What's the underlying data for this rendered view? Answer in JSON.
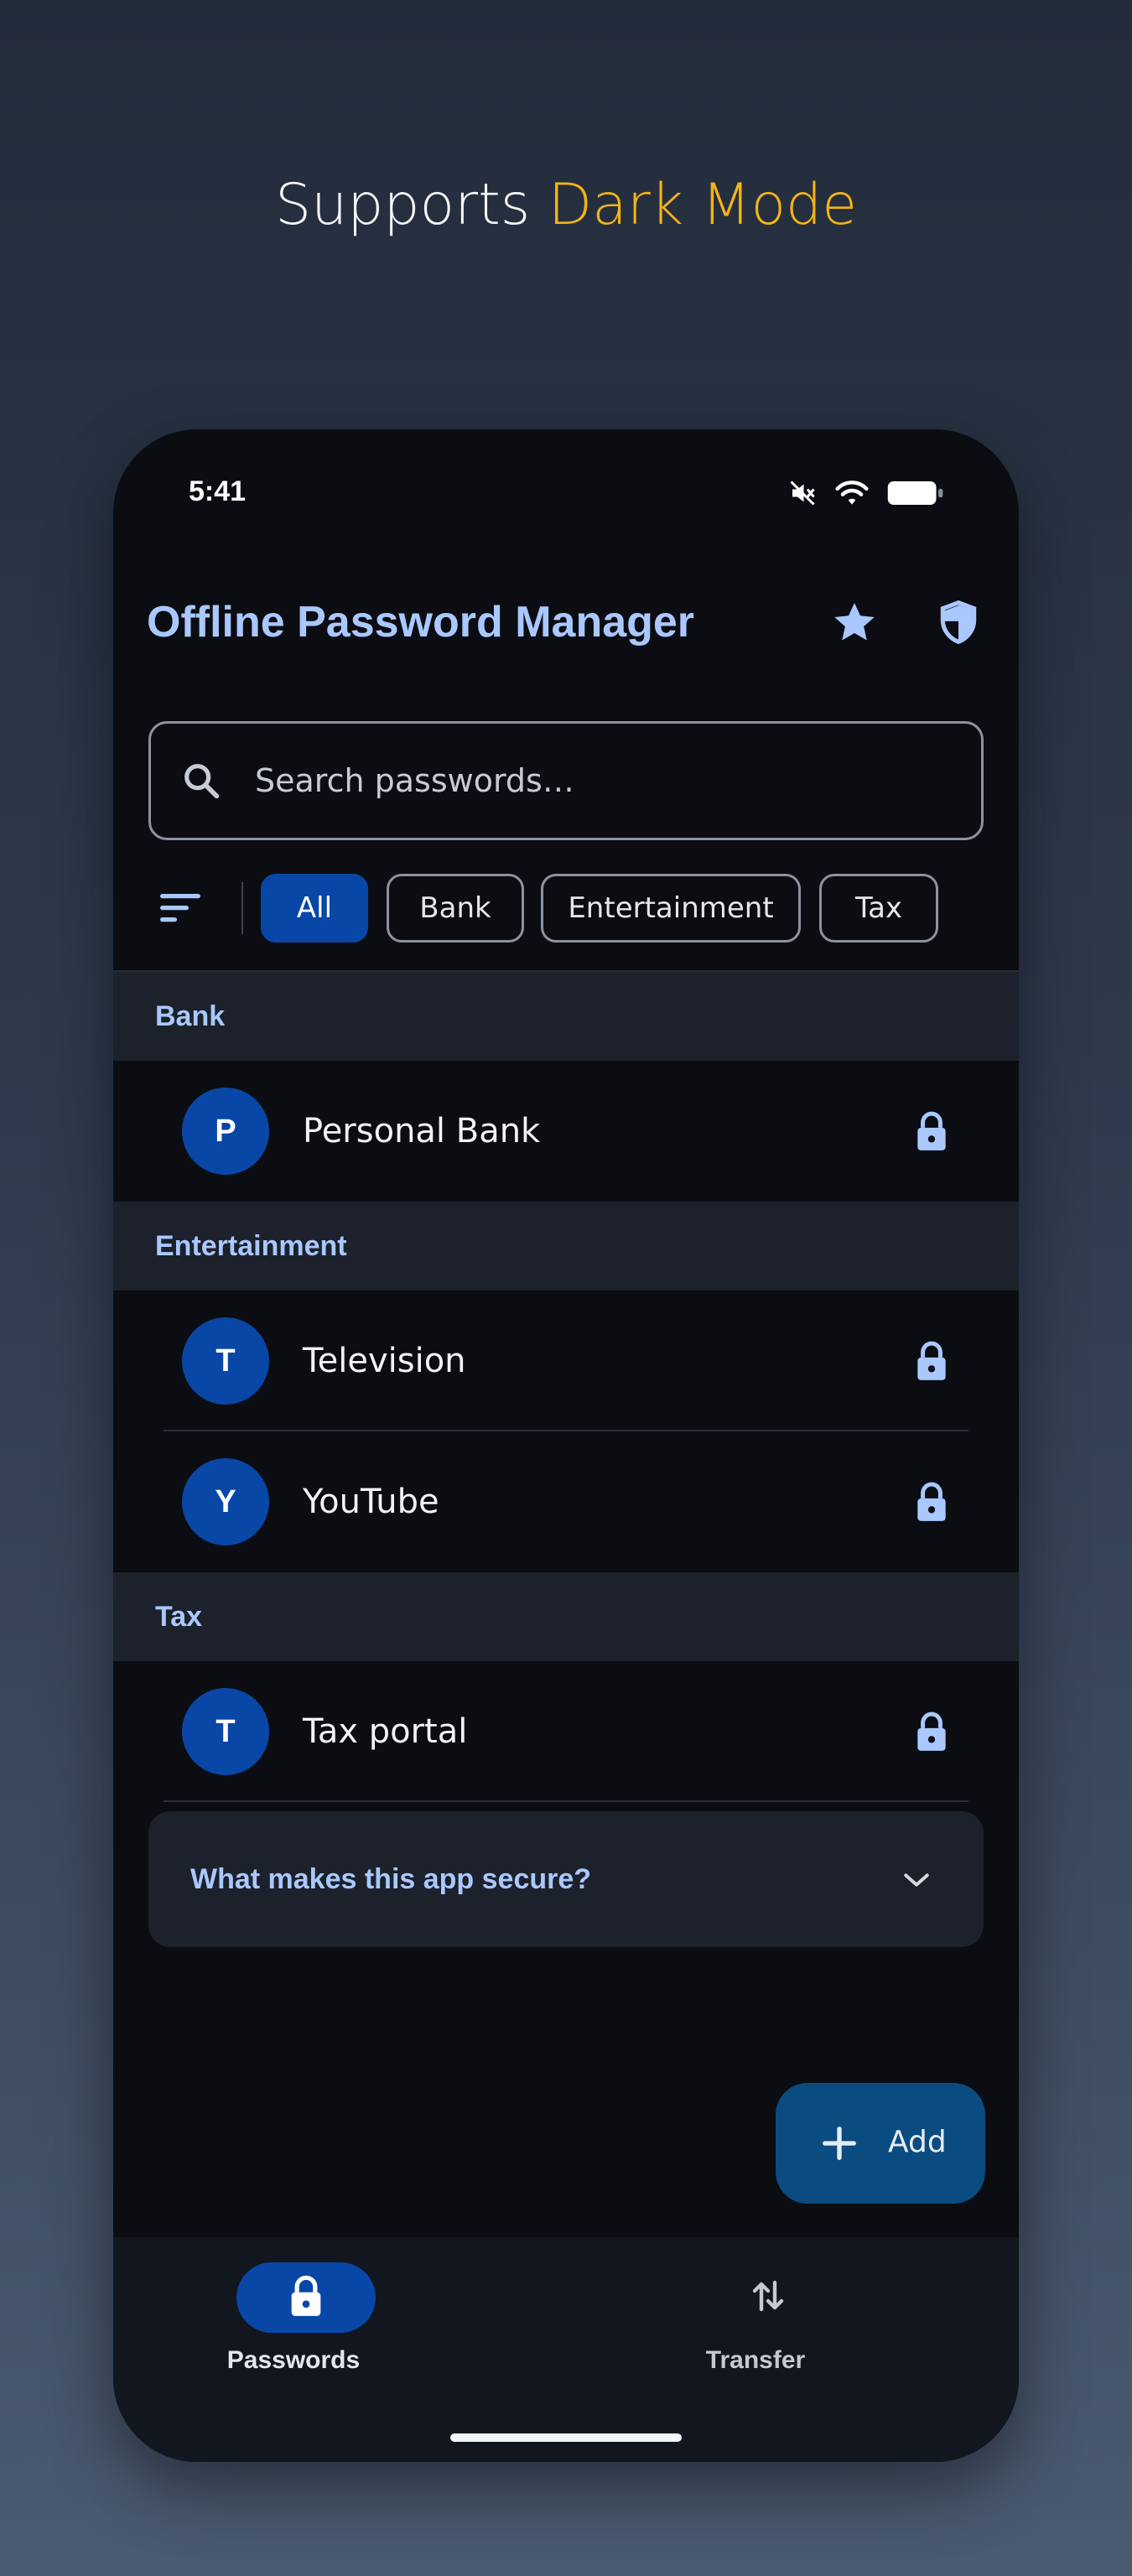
{
  "headline": {
    "prefix": "Supports ",
    "accent": "Dark Mode"
  },
  "colors": {
    "accent_yellow": "#f4b416",
    "primary_blue": "#0847a6",
    "title_blue": "#a9c8ff",
    "background": "#0b0d12"
  },
  "status_bar": {
    "time": "5:41",
    "icons": [
      "muted-icon",
      "wifi-icon",
      "battery-icon"
    ]
  },
  "header": {
    "title": "Offline Password Manager",
    "icons": [
      "star-icon",
      "shield-icon"
    ]
  },
  "search": {
    "placeholder": "Search passwords…",
    "value": "",
    "icon": "search-icon"
  },
  "filters": {
    "sort_icon": "sort-icon",
    "chips": [
      {
        "label": "All",
        "active": true
      },
      {
        "label": "Bank",
        "active": false
      },
      {
        "label": "Entertainment",
        "active": false
      },
      {
        "label": "Tax",
        "active": false
      }
    ]
  },
  "sections": [
    {
      "title": "Bank",
      "items": [
        {
          "initial": "P",
          "name": "Personal Bank",
          "icon": "lock-icon"
        }
      ]
    },
    {
      "title": "Entertainment",
      "items": [
        {
          "initial": "T",
          "name": "Television",
          "icon": "lock-icon"
        },
        {
          "initial": "Y",
          "name": "YouTube",
          "icon": "lock-icon"
        }
      ]
    },
    {
      "title": "Tax",
      "items": [
        {
          "initial": "T",
          "name": "Tax portal",
          "icon": "lock-icon"
        }
      ]
    }
  ],
  "faq": {
    "question": "What makes this app secure?",
    "icon": "chevron-down-icon"
  },
  "fab": {
    "label": "Add",
    "icon": "plus-icon"
  },
  "bottom_nav": [
    {
      "label": "Passwords",
      "icon": "lock-icon",
      "active": true
    },
    {
      "label": "Transfer",
      "icon": "transfer-icon",
      "active": false
    }
  ]
}
